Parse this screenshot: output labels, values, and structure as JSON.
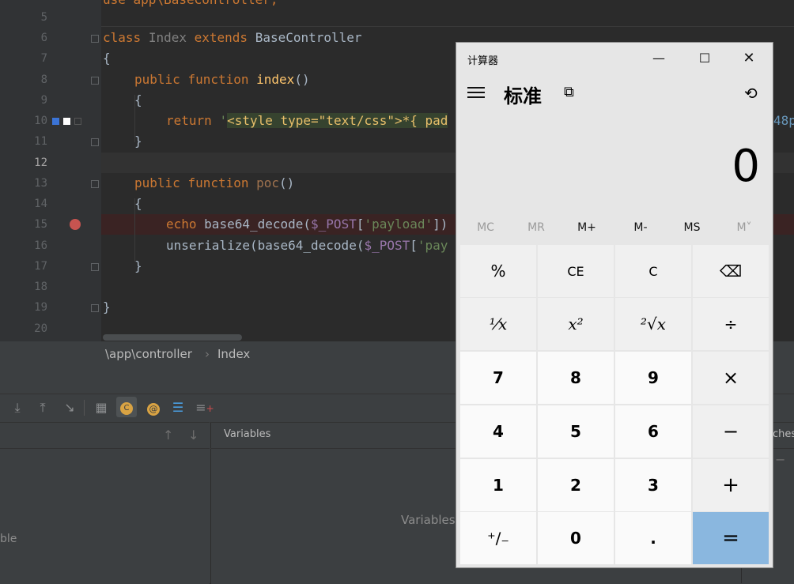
{
  "editor": {
    "breadcrumb": {
      "path": "\\app\\controller",
      "separator": "›",
      "item": "Index"
    },
    "lines": [
      {
        "n": "5"
      },
      {
        "n": "6"
      },
      {
        "n": "7"
      },
      {
        "n": "8"
      },
      {
        "n": "9"
      },
      {
        "n": "10"
      },
      {
        "n": "11"
      },
      {
        "n": "12"
      },
      {
        "n": "13"
      },
      {
        "n": "14"
      },
      {
        "n": "15"
      },
      {
        "n": "16"
      },
      {
        "n": "17"
      },
      {
        "n": "18"
      },
      {
        "n": "19"
      },
      {
        "n": "20"
      }
    ],
    "code": {
      "line4_fragment": "use app\\BaseController;",
      "l6_class": "class",
      "l6_name": "Index",
      "l6_extends": "extends",
      "l6_base": "BaseController",
      "l7": "{",
      "l8_public": "public",
      "l8_function": "function",
      "l8_name": "index",
      "l8_parens": "()",
      "l9": "{",
      "l10_return": "return",
      "l10_quote": "'",
      "l10_str": "<style type=\"text/css\">*{ pad",
      "l10_tail": "48p",
      "l11": "}",
      "l13_public": "public",
      "l13_function": "function",
      "l13_name": "poc",
      "l13_parens": "()",
      "l14": "{",
      "l15_echo": "echo",
      "l15_fn": "base64_decode(",
      "l15_var": "$_POST",
      "l15_open": "[",
      "l15_key": "'payload'",
      "l15_close": "])",
      "l16_fn": "unserialize(base64_decode(",
      "l16_var": "$_POST",
      "l16_open": "[",
      "l16_key": "'pay",
      "l17": "}",
      "l19": "}"
    }
  },
  "debug": {
    "vars_header": "Variables",
    "vars_empty": "Variables",
    "frames_empty_fragment": "ble",
    "watches_fragment": "ches",
    "toolbar_icons": [
      "step-into-icon",
      "step-out-icon",
      "force-step-icon",
      "evaluate-icon",
      "class-filter-icon",
      "at-icon",
      "frames-icon",
      "add-watch-icon"
    ]
  },
  "calculator": {
    "title": "计算器",
    "mode": "标准",
    "display": "0",
    "memory": [
      {
        "label": "MC",
        "enabled": false
      },
      {
        "label": "MR",
        "enabled": false
      },
      {
        "label": "M+",
        "enabled": true
      },
      {
        "label": "M-",
        "enabled": true
      },
      {
        "label": "MS",
        "enabled": true
      },
      {
        "label": "M˅",
        "enabled": false
      }
    ],
    "keys": {
      "percent": "%",
      "ce": "CE",
      "c": "C",
      "backspace": "⌫",
      "reciprocal": "⅟x",
      "square": "x²",
      "sqrt": "²√x",
      "divide": "÷",
      "n7": "7",
      "n8": "8",
      "n9": "9",
      "multiply": "×",
      "n4": "4",
      "n5": "5",
      "n6": "6",
      "minus": "−",
      "n1": "1",
      "n2": "2",
      "n3": "3",
      "plus": "+",
      "negate": "⁺∕₋",
      "n0": "0",
      "decimal": ".",
      "equals": "="
    },
    "colors": {
      "equals_bg": "#8ab7df"
    }
  }
}
